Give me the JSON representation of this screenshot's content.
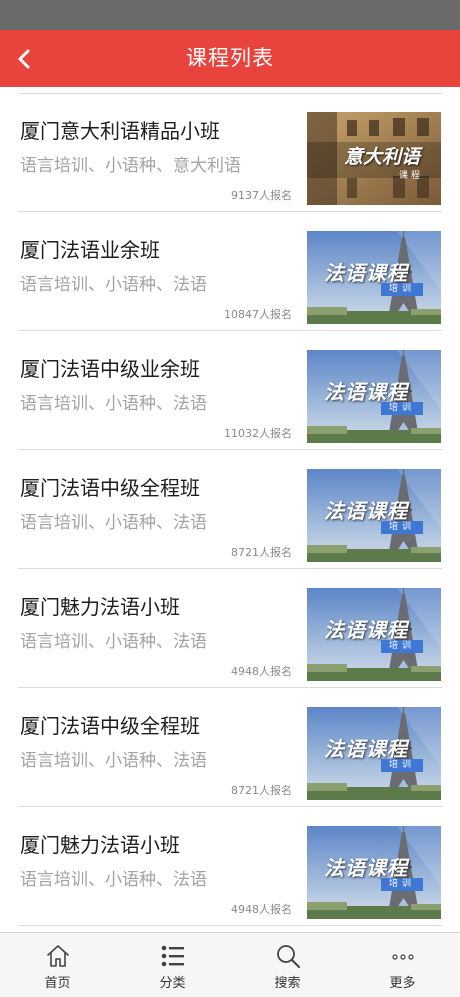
{
  "header": {
    "title": "课程列表"
  },
  "courses": [
    {
      "name": "厦门意大利语精品小班",
      "tags": "语言培训、小语种、意大利语",
      "count": "9137人报名",
      "thumb": {
        "type": "it",
        "title": "意大利语",
        "sub": "课程"
      }
    },
    {
      "name": "厦门法语业余班",
      "tags": "语言培训、小语种、法语",
      "count": "10847人报名",
      "thumb": {
        "type": "fr",
        "title": "法语课程",
        "sub": "培训"
      }
    },
    {
      "name": "厦门法语中级业余班",
      "tags": "语言培训、小语种、法语",
      "count": "11032人报名",
      "thumb": {
        "type": "fr",
        "title": "法语课程",
        "sub": "培训"
      }
    },
    {
      "name": "厦门法语中级全程班",
      "tags": "语言培训、小语种、法语",
      "count": "8721人报名",
      "thumb": {
        "type": "fr",
        "title": "法语课程",
        "sub": "培训"
      }
    },
    {
      "name": "厦门魅力法语小班",
      "tags": "语言培训、小语种、法语",
      "count": "4948人报名",
      "thumb": {
        "type": "fr",
        "title": "法语课程",
        "sub": "培训"
      }
    },
    {
      "name": "厦门法语中级全程班",
      "tags": "语言培训、小语种、法语",
      "count": "8721人报名",
      "thumb": {
        "type": "fr",
        "title": "法语课程",
        "sub": "培训"
      }
    },
    {
      "name": "厦门魅力法语小班",
      "tags": "语言培训、小语种、法语",
      "count": "4948人报名",
      "thumb": {
        "type": "fr",
        "title": "法语课程",
        "sub": "培训"
      }
    }
  ],
  "tabbar": {
    "items": [
      {
        "label": "首页",
        "icon": "home-icon"
      },
      {
        "label": "分类",
        "icon": "category-list-icon"
      },
      {
        "label": "搜索",
        "icon": "search-icon"
      },
      {
        "label": "更多",
        "icon": "more-icon"
      }
    ]
  },
  "colors": {
    "accent": "#e8433d",
    "status_bar": "#6a6a6a",
    "muted_text": "#a3a3a3"
  }
}
